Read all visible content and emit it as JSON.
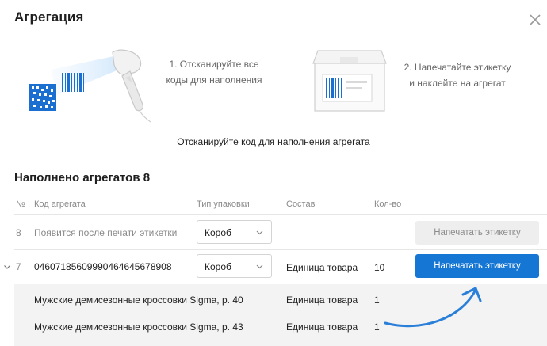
{
  "dialog": {
    "title": "Агрегация",
    "close_icon": "close-icon"
  },
  "instructions": {
    "step1_line1": "1. Отсканируйте все",
    "step1_line2": "коды для наполнения",
    "step2_line1": "2. Напечатайте этикетку",
    "step2_line2": "и наклейте на агрегат",
    "scan_hint": "Отсканируйте код для наполнения агрегата"
  },
  "summary": {
    "title": "Наполнено агрегатов 8"
  },
  "table": {
    "headers": {
      "num": "№",
      "code": "Код агрегата",
      "package": "Тип упаковки",
      "content": "Состав",
      "qty": "Кол-во"
    },
    "rows": [
      {
        "num": "8",
        "code": "Появится после печати этикетки",
        "package": "Короб",
        "content": "",
        "qty": "",
        "action": "Напечатать этикетку",
        "action_state": "disabled"
      },
      {
        "num": "7",
        "code": "0460718560999046464567890 8",
        "package": "Короб",
        "content": "Единица товара",
        "qty": "10",
        "action": "Напечатать этикетку",
        "action_state": "enabled",
        "expanded": true
      }
    ],
    "subrows": [
      {
        "name": "Мужские демисезонные кроссовки Sigma, р. 40",
        "content": "Единица товара",
        "qty": "1"
      },
      {
        "name": "Мужские демисезонные кроссовки Sigma, р. 43",
        "content": "Единица товара",
        "qty": "1"
      }
    ]
  },
  "colors": {
    "primary": "#1576d3",
    "arrow": "#2a7fd8",
    "barcode": "#1a6fd0"
  }
}
